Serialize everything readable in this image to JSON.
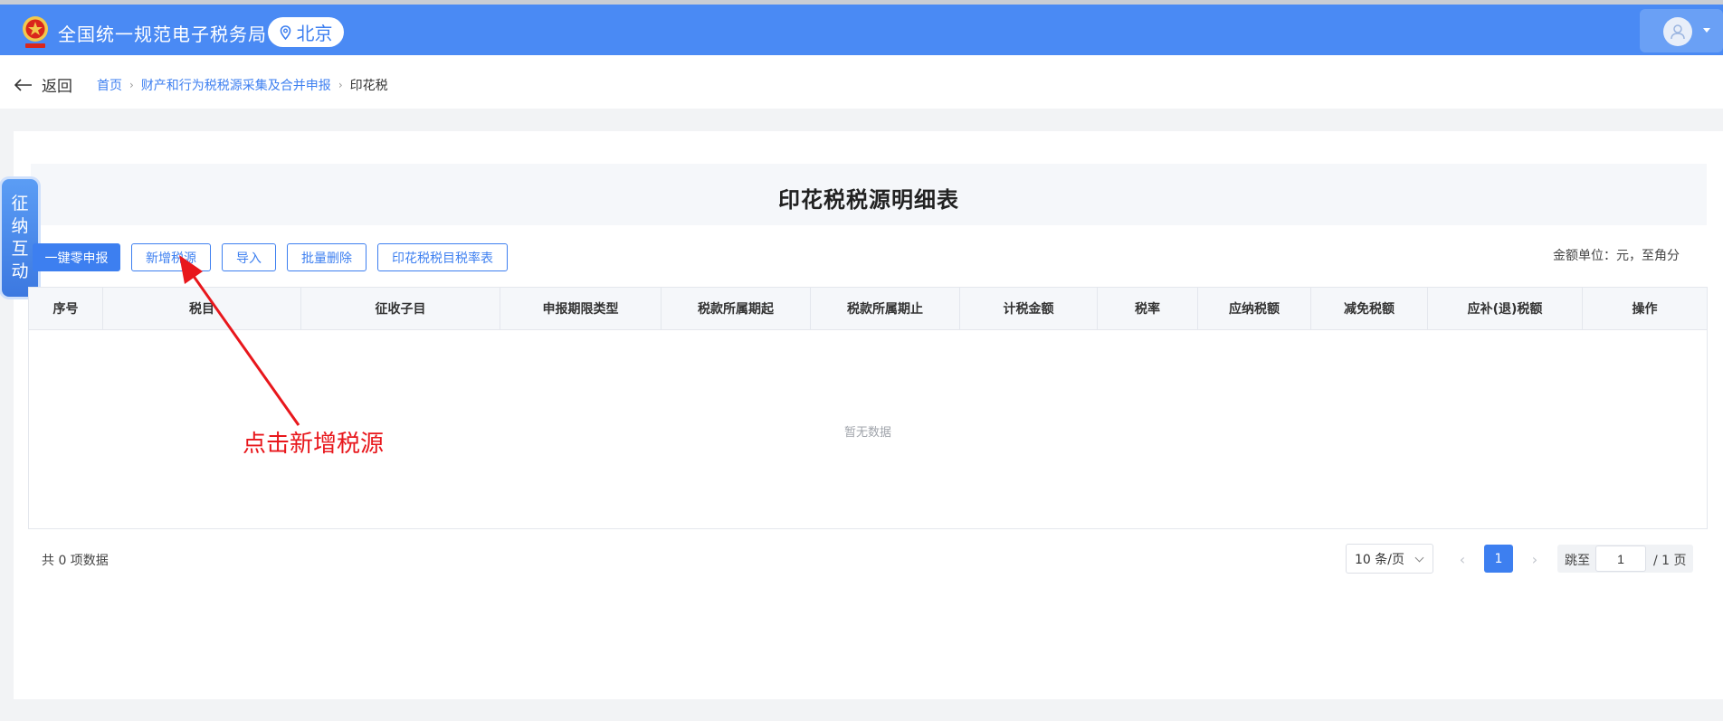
{
  "header": {
    "site_title": "全国统一规范电子税务局",
    "city": "北京",
    "brand_color": "#4a8af4"
  },
  "nav": {
    "back_label": "返回",
    "breadcrumb": [
      "首页",
      "财产和行为税税源采集及合并申报",
      "印花税"
    ]
  },
  "side_tab": {
    "label": [
      "征",
      "纳",
      "互",
      "动"
    ]
  },
  "form": {
    "title": "印花税税源明细表",
    "unit_note": "金额单位：元，至角分"
  },
  "toolbar": {
    "buttons": [
      "一键零申报",
      "新增税源",
      "导入",
      "批量删除",
      "印花税税目税率表"
    ]
  },
  "table": {
    "columns": [
      "序号",
      "税目",
      "征收子目",
      "申报期限类型",
      "税款所属期起",
      "税款所属期止",
      "计税金额",
      "税率",
      "应纳税额",
      "减免税额",
      "应补(退)税额",
      "操作"
    ],
    "empty_text": "暂无数据"
  },
  "pagination": {
    "total_text": "共 0 项数据",
    "page_size": "10 条/页",
    "current_page": "1",
    "jump_label": "跳至",
    "jump_value": "1",
    "total_pages": "/ 1 页",
    "prev_icon": "chevron-left-icon",
    "next_icon": "chevron-right-icon"
  },
  "annotation": {
    "text": "点击新增税源",
    "color": "#e8171c"
  }
}
